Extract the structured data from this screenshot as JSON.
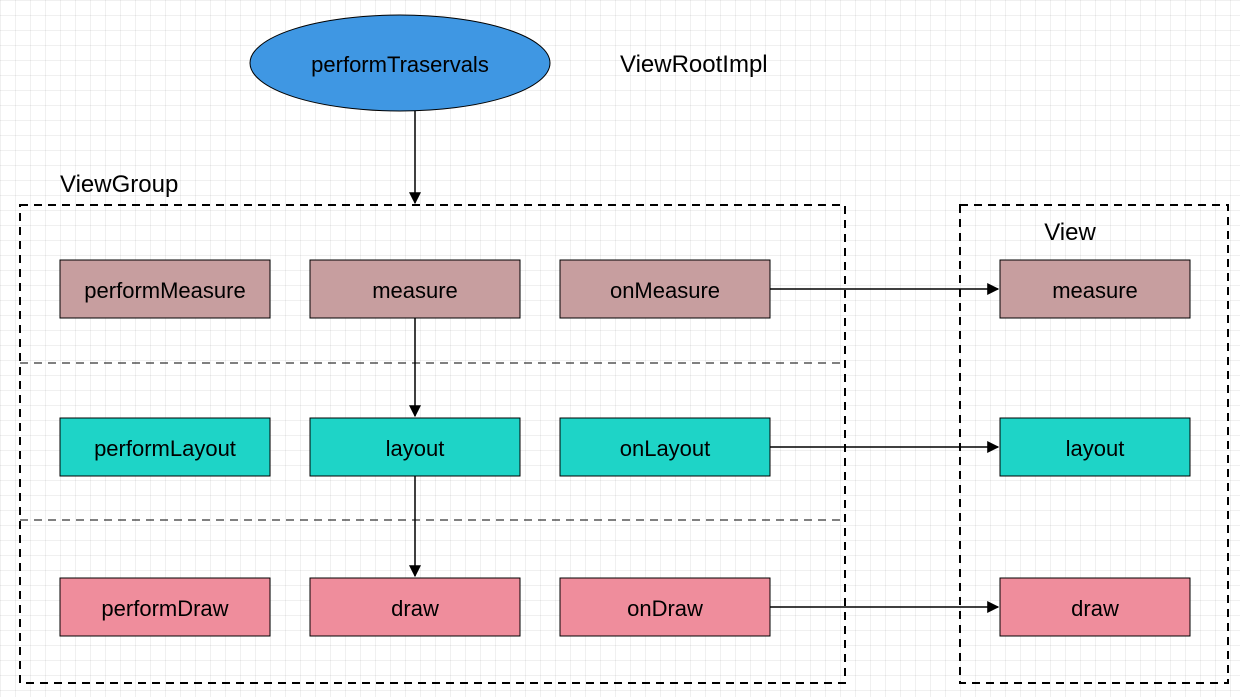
{
  "root": {
    "ellipse_label": "performTraservals",
    "class_label": "ViewRootImpl"
  },
  "groups": {
    "viewgroup_label": "ViewGroup",
    "view_label": "View"
  },
  "viewgroup": {
    "measure": {
      "perform": "performMeasure",
      "call": "measure",
      "on": "onMeasure"
    },
    "layout": {
      "perform": "performLayout",
      "call": "layout",
      "on": "onLayout"
    },
    "draw": {
      "perform": "performDraw",
      "call": "draw",
      "on": "onDraw"
    }
  },
  "view": {
    "measure": "measure",
    "layout": "layout",
    "draw": "draw"
  },
  "colors": {
    "ellipse": "#3f97e3",
    "measure_row": "#c79e9f",
    "layout_row": "#1ed4c7",
    "draw_row": "#ef8d9c"
  },
  "chart_data": {
    "type": "flow-diagram",
    "description": "Android View traversal pipeline originating at ViewRootImpl.performTraversals, dispatched through ViewGroup (performMeasure→measure→onMeasure, performLayout→layout→onLayout, performDraw→draw→onDraw), each dispatching to child View (measure, layout, draw).",
    "nodes": [
      {
        "id": "performTraservals",
        "owner": "ViewRootImpl",
        "shape": "ellipse"
      },
      {
        "id": "performMeasure",
        "owner": "ViewGroup",
        "phase": "measure"
      },
      {
        "id": "measure_vg",
        "label": "measure",
        "owner": "ViewGroup",
        "phase": "measure"
      },
      {
        "id": "onMeasure",
        "owner": "ViewGroup",
        "phase": "measure"
      },
      {
        "id": "performLayout",
        "owner": "ViewGroup",
        "phase": "layout"
      },
      {
        "id": "layout_vg",
        "label": "layout",
        "owner": "ViewGroup",
        "phase": "layout"
      },
      {
        "id": "onLayout",
        "owner": "ViewGroup",
        "phase": "layout"
      },
      {
        "id": "performDraw",
        "owner": "ViewGroup",
        "phase": "draw"
      },
      {
        "id": "draw_vg",
        "label": "draw",
        "owner": "ViewGroup",
        "phase": "draw"
      },
      {
        "id": "onDraw",
        "owner": "ViewGroup",
        "phase": "draw"
      },
      {
        "id": "measure_v",
        "label": "measure",
        "owner": "View",
        "phase": "measure"
      },
      {
        "id": "layout_v",
        "label": "layout",
        "owner": "View",
        "phase": "layout"
      },
      {
        "id": "draw_v",
        "label": "draw",
        "owner": "View",
        "phase": "draw"
      }
    ],
    "edges": [
      {
        "from": "performTraservals",
        "to": "measure_vg"
      },
      {
        "from": "measure_vg",
        "to": "layout_vg"
      },
      {
        "from": "layout_vg",
        "to": "draw_vg"
      },
      {
        "from": "onMeasure",
        "to": "measure_v"
      },
      {
        "from": "onLayout",
        "to": "layout_v"
      },
      {
        "from": "onDraw",
        "to": "draw_v"
      }
    ],
    "containers": [
      {
        "id": "ViewGroup",
        "contains": [
          "performMeasure",
          "measure_vg",
          "onMeasure",
          "performLayout",
          "layout_vg",
          "onLayout",
          "performDraw",
          "draw_vg",
          "onDraw"
        ]
      },
      {
        "id": "View",
        "contains": [
          "measure_v",
          "layout_v",
          "draw_v"
        ]
      }
    ]
  }
}
